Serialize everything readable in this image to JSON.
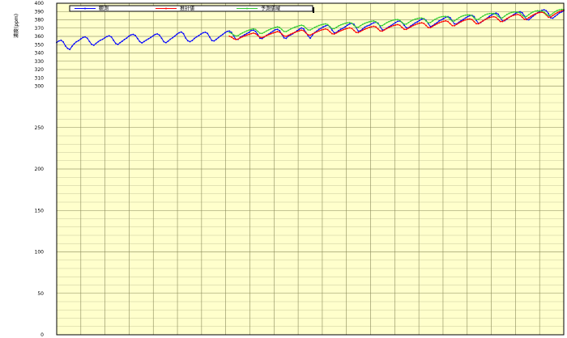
{
  "chart_data": {
    "type": "line",
    "ylabel": "濃度(ppm)",
    "ylim": [
      0,
      400
    ],
    "yticks": [
      0,
      50,
      100,
      150,
      200,
      250,
      300,
      310,
      320,
      330,
      340,
      350,
      360,
      370,
      380,
      390,
      400
    ],
    "x_grid_count": 21,
    "grid": true,
    "legend_position": "top",
    "colors": {
      "background": "#ffffcc",
      "grid_major": "#8a8a5a",
      "grid_minor": "#c8c89a"
    },
    "series": [
      {
        "name": "観測",
        "color": "#0000ff",
        "marker": "dot",
        "values": [
          352.6,
          354.5,
          355.3,
          353.3,
          348.4,
          345.5,
          344.2,
          348.0,
          351.1,
          353.5,
          354.8,
          356.9,
          358.7,
          359.4,
          357.8,
          353.9,
          350.3,
          349.3,
          351.6,
          353.6,
          355.4,
          356.5,
          358.3,
          359.8,
          360.7,
          359.4,
          355.3,
          351.5,
          350.2,
          352.4,
          354.2,
          356.3,
          357.9,
          360.2,
          361.8,
          362.4,
          361.1,
          357.4,
          353.8,
          352.1,
          353.8,
          355.5,
          357.1,
          358.6,
          360.4,
          362.3,
          363.0,
          361.6,
          357.8,
          353.6,
          352.4,
          354.3,
          356.6,
          358.3,
          360.3,
          362.6,
          364.4,
          365.3,
          363.3,
          358.0,
          354.7,
          353.6,
          355.0,
          357.5,
          359.4,
          361.0,
          362.8,
          364.4,
          365.0,
          363.6,
          359.1,
          355.0,
          354.5,
          356.4,
          358.5,
          360.6,
          362.4,
          364.5,
          366.0,
          366.5,
          364.8,
          360.4,
          356.4,
          356.3,
          359.0,
          360.4,
          362.0,
          363.5,
          364.8,
          367.2,
          367.5,
          366.0,
          362.4,
          357.7,
          357.3,
          359.3,
          361.3,
          362.8,
          364.6,
          366.3,
          368.0,
          368.5,
          366.9,
          362.5,
          358.2,
          357.6,
          360.3,
          361.6,
          363.1,
          364.9,
          366.9,
          368.6,
          370.2,
          369.0,
          364.9,
          360.8,
          357.7,
          361.5,
          364.6,
          366.4,
          368.5,
          370.0,
          371.5,
          372.6,
          373.6,
          371.6,
          367.6,
          364.3,
          364.7,
          367.0,
          368.6,
          369.9,
          371.5,
          373.5,
          375.0,
          375.7,
          374.6,
          370.6,
          366.3,
          366.8,
          369.0,
          371.2,
          372.5,
          373.4,
          375.1,
          376.3,
          377.1,
          376.1,
          371.9,
          367.8,
          368.0,
          370.0,
          371.6,
          373.1,
          374.9,
          376.6,
          378.2,
          378.6,
          376.8,
          373.4,
          370.4,
          370.5,
          372.7,
          374.3,
          376.2,
          377.5,
          379.2,
          380.8,
          381.4,
          379.4,
          375.5,
          371.8,
          372.9,
          374.8,
          376.5,
          378.7,
          379.9,
          381.5,
          383.0,
          383.9,
          382.7,
          378.8,
          375.0,
          375.1,
          377.0,
          378.7,
          380.4,
          382.1,
          383.8,
          384.9,
          385.5,
          383.9,
          379.3,
          375.6,
          376.6,
          378.6,
          380.4,
          382.1,
          384.3,
          385.8,
          387.1,
          388.2,
          386.8,
          382.6,
          378.6,
          378.9,
          380.9,
          382.9,
          384.5,
          386.2,
          387.9,
          388.9,
          389.7,
          388.5,
          384.6,
          380.2,
          380.0,
          382.3,
          384.5,
          386.5,
          388.4,
          389.9,
          391.5,
          392.1,
          390.9,
          387.6,
          382.4,
          381.9,
          384.1,
          386.1,
          388.3,
          389.4,
          390.9
        ]
      },
      {
        "name": "推計値",
        "color": "#ff0000",
        "marker": "dot",
        "values": [
          360.2,
          359.1,
          357.2,
          356.2,
          356.7,
          358.3,
          359.5,
          360.5,
          361.6,
          362.4,
          363.3,
          364.0,
          363.2,
          361.1,
          358.9,
          358.5,
          359.7,
          360.9,
          362.1,
          363.1,
          364.1,
          364.9,
          365.8,
          365.1,
          362.8,
          360.5,
          360.1,
          361.3,
          362.6,
          363.8,
          364.9,
          365.9,
          366.7,
          367.5,
          366.8,
          364.3,
          361.9,
          361.5,
          362.9,
          364.2,
          365.4,
          366.5,
          367.7,
          368.3,
          368.9,
          368.1,
          365.6,
          363.2,
          362.8,
          364.2,
          365.6,
          366.8,
          367.9,
          368.9,
          369.6,
          370.3,
          369.6,
          367.2,
          364.8,
          364.5,
          366.0,
          367.4,
          368.7,
          369.8,
          370.8,
          371.6,
          372.2,
          371.5,
          369.0,
          366.6,
          366.4,
          367.9,
          369.4,
          370.7,
          372.0,
          372.9,
          373.7,
          374.2,
          373.4,
          370.9,
          368.5,
          368.4,
          370.0,
          371.5,
          372.9,
          374.1,
          375.1,
          375.9,
          376.4,
          375.6,
          373.1,
          370.6,
          370.5,
          372.1,
          373.7,
          375.1,
          376.4,
          377.4,
          378.2,
          378.7,
          377.9,
          375.4,
          372.9,
          372.8,
          374.5,
          376.1,
          377.6,
          378.9,
          379.9,
          380.7,
          381.1,
          380.3,
          377.8,
          375.3,
          375.2,
          377.0,
          378.7,
          380.2,
          381.6,
          382.6,
          383.4,
          383.8,
          383.0,
          380.5,
          377.9,
          377.9,
          379.7,
          381.5,
          383.0,
          384.4,
          385.4,
          386.1,
          386.5,
          385.6,
          383.1,
          380.6,
          380.6,
          382.5,
          384.3,
          385.8,
          387.2,
          388.2,
          388.8,
          389.2,
          388.3,
          385.8,
          383.2,
          383.3,
          385.2,
          387.0,
          388.5,
          389.9,
          390.9,
          391.5
        ]
      },
      {
        "name": "予測値域",
        "color": "#33cc33",
        "marker": "dot",
        "values": [
          364.6,
          363.7,
          361.6,
          360.5,
          361.0,
          362.8,
          364.2,
          365.4,
          366.6,
          367.6,
          368.5,
          369.2,
          368.4,
          366.1,
          363.8,
          363.6,
          365.0,
          366.5,
          367.8,
          369.0,
          370.0,
          370.8,
          371.6,
          370.8,
          368.3,
          366.0,
          365.8,
          367.3,
          368.8,
          370.1,
          371.2,
          372.1,
          372.9,
          373.5,
          372.7,
          370.1,
          367.8,
          367.7,
          369.3,
          370.8,
          372.1,
          373.1,
          374.0,
          374.6,
          375.1,
          374.2,
          371.7,
          369.4,
          369.4,
          371.0,
          372.6,
          373.9,
          374.9,
          375.8,
          376.3,
          376.8,
          375.9,
          373.3,
          371.1,
          371.1,
          372.9,
          374.5,
          375.8,
          376.8,
          377.6,
          378.2,
          378.6,
          377.7,
          375.1,
          372.9,
          373.0,
          374.8,
          376.5,
          377.8,
          378.8,
          379.6,
          380.1,
          380.4,
          379.5,
          376.9,
          374.7,
          374.9,
          376.7,
          378.4,
          379.8,
          380.8,
          381.6,
          382.0,
          382.2,
          381.2,
          378.6,
          376.5,
          376.7,
          378.6,
          380.4,
          381.8,
          382.9,
          383.6,
          384.0,
          384.1,
          383.1,
          380.5,
          378.4,
          378.7,
          380.6,
          382.4,
          383.9,
          384.9,
          385.6,
          385.9,
          385.9,
          384.9,
          382.3,
          380.3,
          380.6,
          382.6,
          384.4,
          385.9,
          386.9,
          387.5,
          387.7,
          387.6,
          386.6,
          384.0,
          382.1,
          382.5,
          384.5,
          386.4,
          387.8,
          388.8,
          389.3,
          389.4,
          389.2,
          388.1,
          385.5,
          383.6,
          384.1,
          386.2,
          388.1,
          389.5,
          390.5,
          390.9,
          390.9,
          390.6,
          389.5,
          386.9,
          385.1,
          385.7,
          387.8,
          389.7,
          391.2,
          392.1,
          392.5,
          392.4
        ]
      }
    ]
  }
}
